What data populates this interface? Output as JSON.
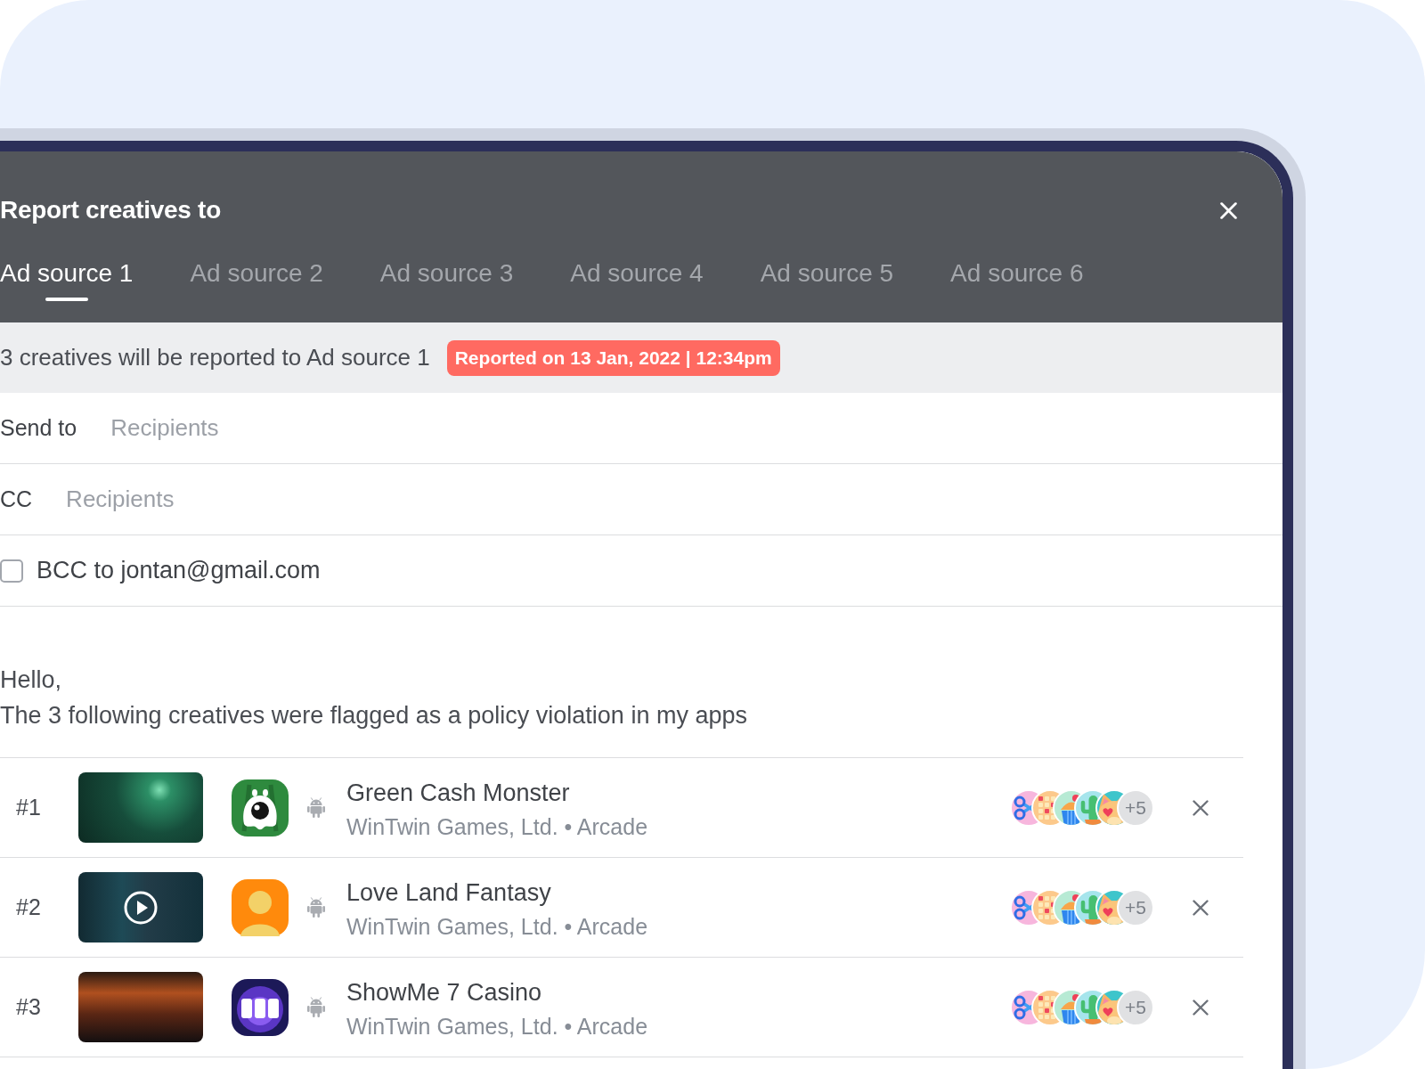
{
  "dialog": {
    "title": "Report creatives to"
  },
  "tabs": [
    {
      "label": "Ad source 1",
      "selected": true
    },
    {
      "label": "Ad source 2",
      "selected": false
    },
    {
      "label": "Ad source 3",
      "selected": false
    },
    {
      "label": "Ad source 4",
      "selected": false
    },
    {
      "label": "Ad source 5",
      "selected": false
    },
    {
      "label": "Ad source 6",
      "selected": false
    }
  ],
  "info_bar": {
    "text": "3 creatives will be reported to Ad source 1",
    "badge": "Reported on 13 Jan, 2022 | 12:34pm"
  },
  "send_to": {
    "label": "Send to",
    "placeholder": "Recipients"
  },
  "cc": {
    "label": "CC",
    "placeholder": "Recipients"
  },
  "bcc": {
    "label": "BCC to jontan@gmail.com",
    "checked": false
  },
  "message": {
    "greeting": "Hello,",
    "body": "The 3 following creatives were flagged as a policy violation in my apps"
  },
  "creatives": [
    {
      "rank": "#1",
      "thumbnail": {
        "kind": "image"
      },
      "app_icon": {
        "color": "#2e8a3e"
      },
      "name": "Green Cash Monster",
      "subtitle": "WinTwin Games, Ltd. • Arcade",
      "more": "+5"
    },
    {
      "rank": "#2",
      "thumbnail": {
        "kind": "video"
      },
      "app_icon": {
        "color": "#ff8a0c"
      },
      "name": "Love Land Fantasy",
      "subtitle": "WinTwin Games, Ltd. • Arcade",
      "more": "+5"
    },
    {
      "rank": "#3",
      "thumbnail": {
        "kind": "image"
      },
      "app_icon": {
        "color": "#1c1958"
      },
      "name": "ShowMe 7 Casino",
      "subtitle": "WinTwin Games, Ltd. • Arcade",
      "more": "+5"
    }
  ]
}
